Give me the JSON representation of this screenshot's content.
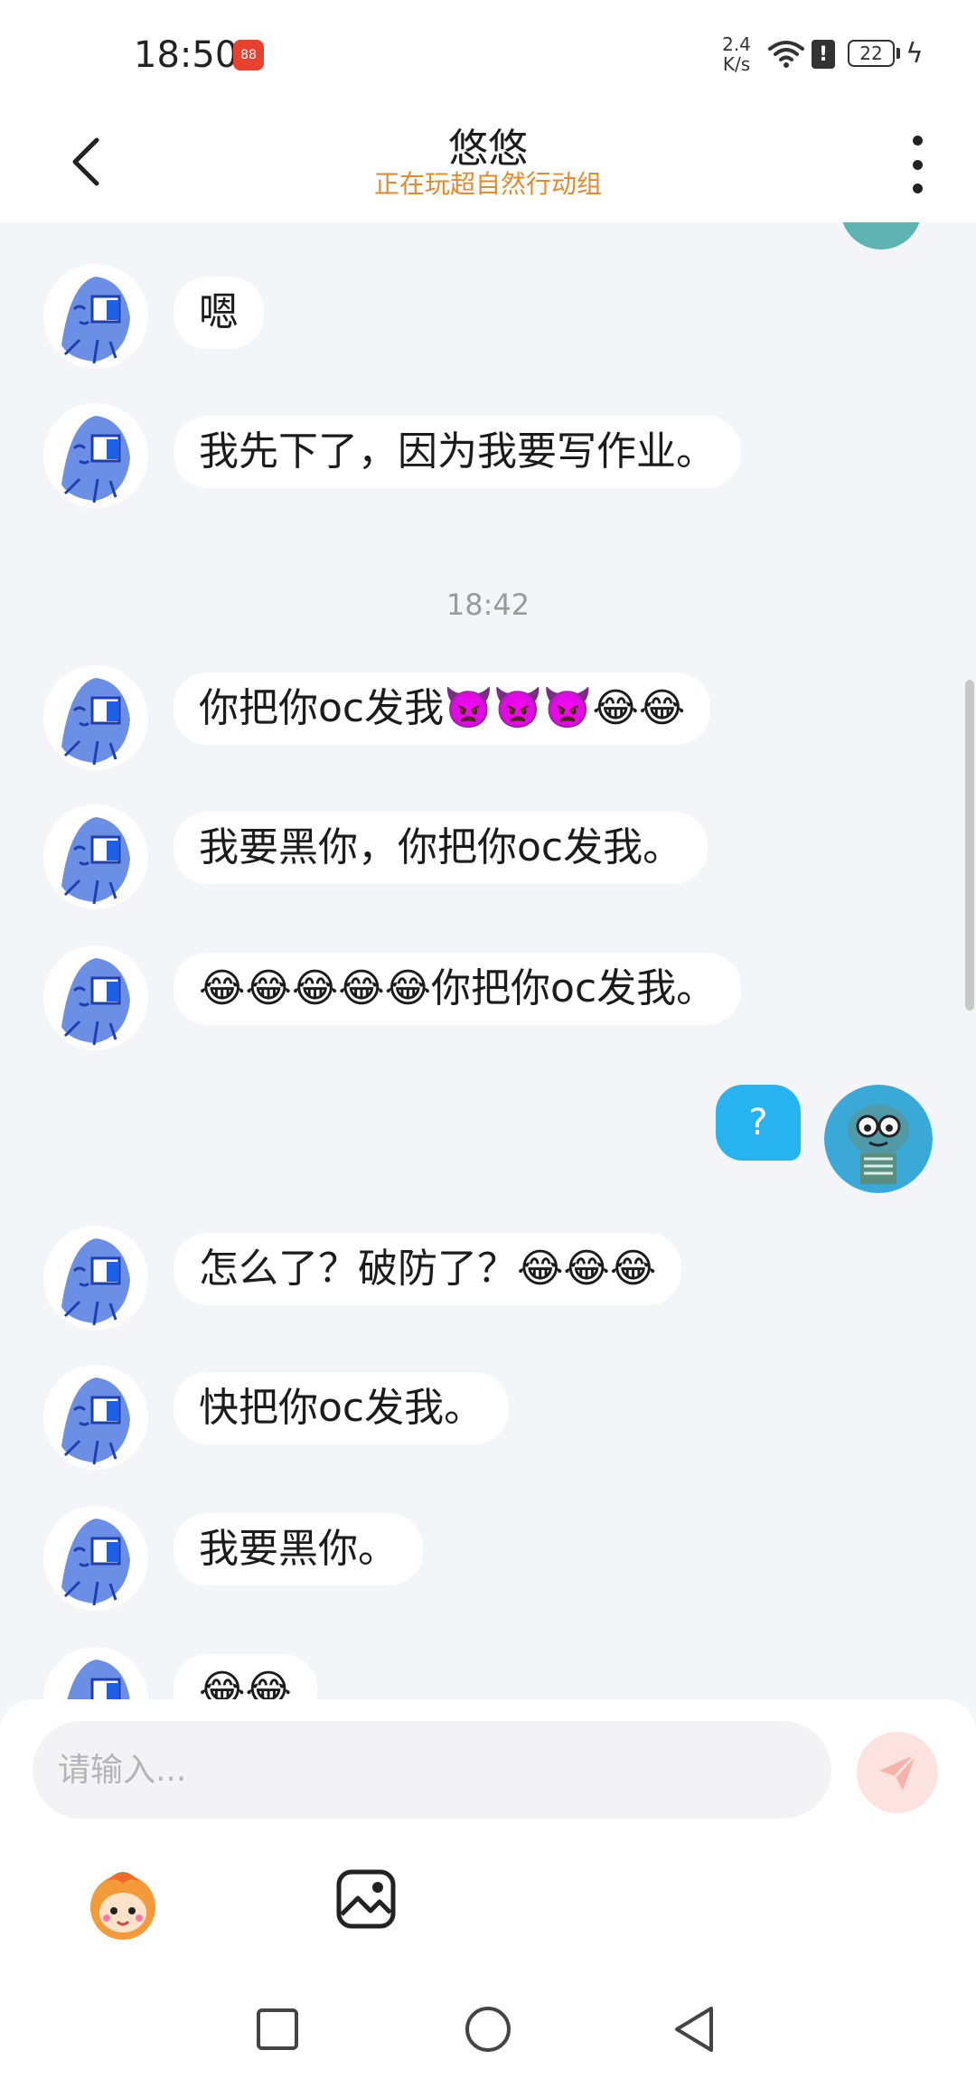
{
  "status_bar": {
    "time": "18:50",
    "app_icon_text": "88",
    "net_speed_value": "2.4",
    "net_speed_unit": "K/s",
    "battery": "22"
  },
  "header": {
    "title": "悠悠",
    "subtitle": "正在玩超自然行动组"
  },
  "chat": {
    "messages": [
      {
        "side": "left",
        "text": "嗯"
      },
      {
        "side": "left",
        "text": "我先下了，因为我要写作业。"
      },
      {
        "type": "timestamp",
        "text": "18:42"
      },
      {
        "side": "left",
        "text": "你把你oc发我👿👿👿😂😂"
      },
      {
        "side": "left",
        "text": "我要黑你，你把你oc发我。"
      },
      {
        "side": "left",
        "text": "😂😂😂😂😂你把你oc发我。"
      },
      {
        "side": "right",
        "text": "?"
      },
      {
        "side": "left",
        "text": "怎么了？破防了？😂😂😂"
      },
      {
        "side": "left",
        "text": "快把你oc发我。"
      },
      {
        "side": "left",
        "text": "我要黑你。"
      },
      {
        "side": "left",
        "text": "😂😂"
      }
    ]
  },
  "composer": {
    "placeholder": "请输入..."
  },
  "icons": [
    "back-arrow-icon",
    "more-dots-icon",
    "send-icon",
    "emoji-mascot-icon",
    "image-icon",
    "recent-apps-icon",
    "home-icon",
    "back-triangle-icon"
  ],
  "colors": {
    "accent_orange": "#e58a2b",
    "my_bubble": "#27b3f0",
    "background": "#f4f5f9"
  }
}
